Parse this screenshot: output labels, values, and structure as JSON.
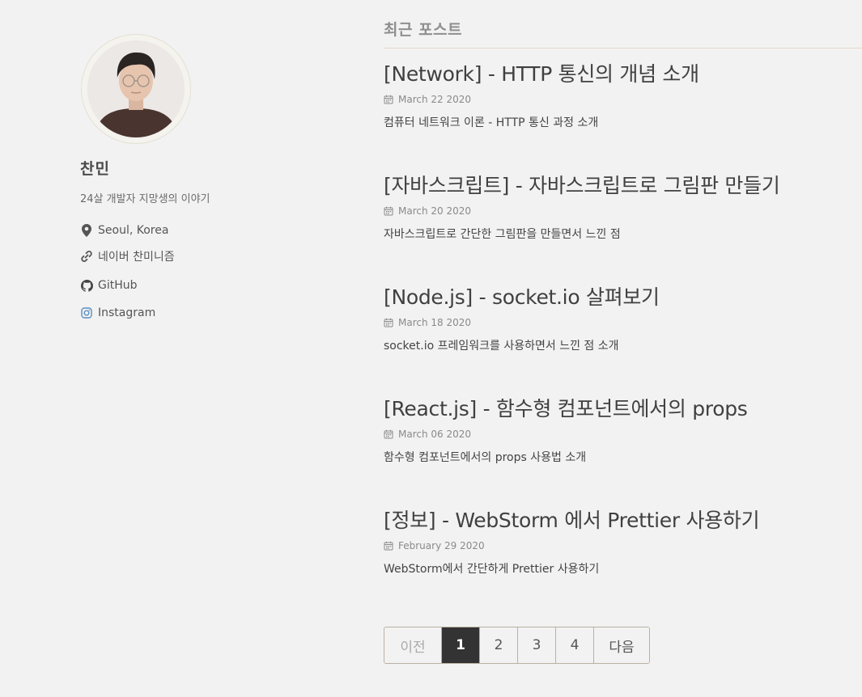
{
  "sidebar": {
    "author_name": "찬민",
    "author_bio": "24살 개발자 지망생의 이야기",
    "links": [
      {
        "icon": "location-pin-icon",
        "label": "Seoul, Korea"
      },
      {
        "icon": "link-icon",
        "label": "네이버 찬미니즘"
      },
      {
        "icon": "github-icon",
        "label": "GitHub"
      },
      {
        "icon": "instagram-icon",
        "label": "Instagram"
      }
    ]
  },
  "main": {
    "section_title": "최근 포스트",
    "posts": [
      {
        "title": "[Network] - HTTP 통신의 개념 소개",
        "date": "March 22 2020",
        "excerpt": "컴퓨터 네트워크 이론 - HTTP 통신 과정 소개"
      },
      {
        "title": "[자바스크립트] - 자바스크립트로 그림판 만들기",
        "date": "March 20 2020",
        "excerpt": "자바스크립트로 간단한 그림판을 만들면서 느낀 점"
      },
      {
        "title": "[Node.js] - socket.io 살펴보기",
        "date": "March 18 2020",
        "excerpt": "socket.io 프레임워크를 사용하면서 느낀 점 소개"
      },
      {
        "title": "[React.js] - 함수형 컴포넌트에서의 props",
        "date": "March 06 2020",
        "excerpt": "함수형 컴포넌트에서의 props 사용법 소개"
      },
      {
        "title": "[정보] - WebStorm 에서 Prettier 사용하기",
        "date": "February 29 2020",
        "excerpt": "WebStorm에서 간단하게 Prettier 사용하기"
      }
    ]
  },
  "pagination": {
    "prev_label": "이전",
    "pages": [
      "1",
      "2",
      "3",
      "4"
    ],
    "current_page": "1",
    "next_label": "다음"
  },
  "colors": {
    "background": "#f2f2f2",
    "active_page": "#333333",
    "divider": "#e2d8cc",
    "instagram_icon": "#5b8fbf"
  }
}
